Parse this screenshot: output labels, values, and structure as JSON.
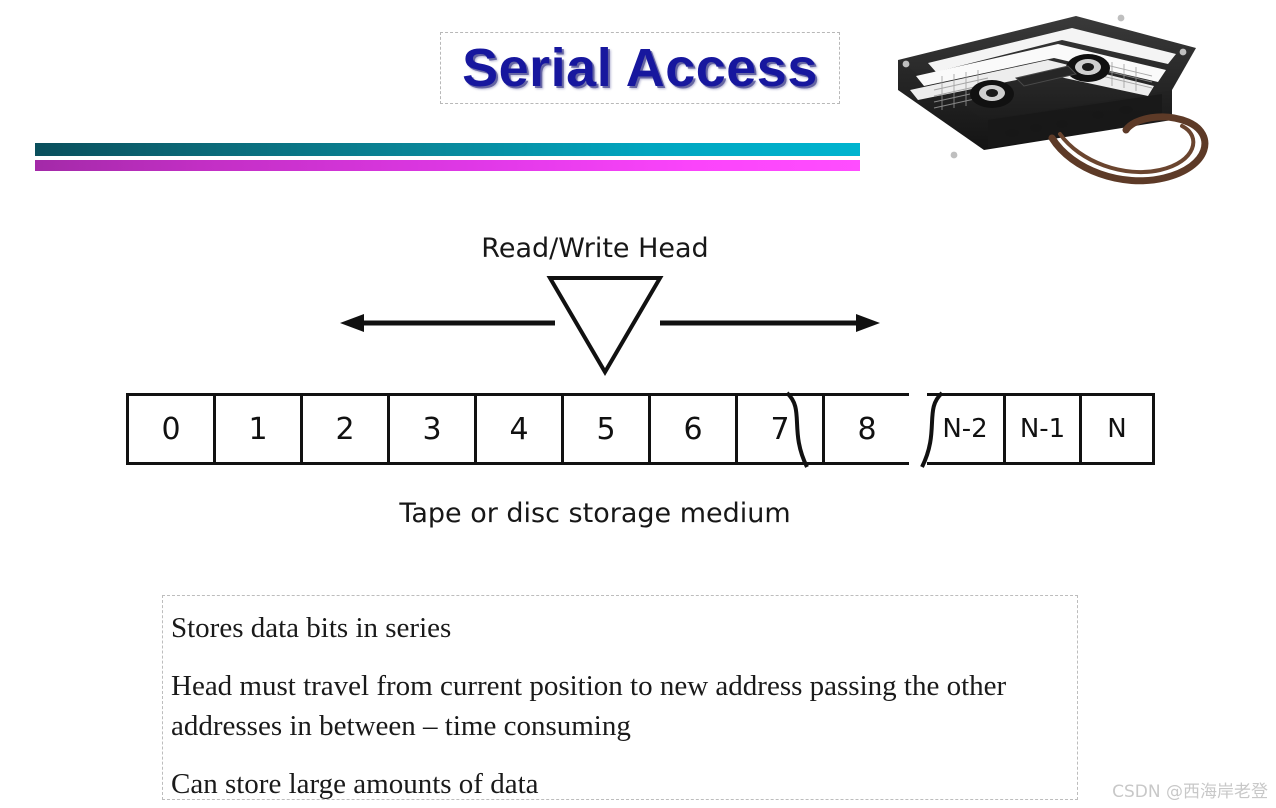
{
  "slide": {
    "title": "Serial Access",
    "title_color": "#17179e",
    "background": "#ffffff"
  },
  "divider_bars": [
    {
      "name": "teal-bar",
      "from": "#0a4f5c",
      "to": "#00b4cf"
    },
    {
      "name": "magenta-bar",
      "from": "#a32aa8",
      "to": "#ff4dff"
    }
  ],
  "image": {
    "alt": "cassette-tape-photo",
    "body_color": "#2b2b2b",
    "tape_color": "#5a3a2a",
    "label_color": "#f2f2f2"
  },
  "diagram": {
    "head_label": "Read/Write Head",
    "medium_caption": "Tape or disc storage medium",
    "cells_left": [
      "0",
      "1",
      "2",
      "3",
      "4",
      "5",
      "6",
      "7",
      "8"
    ],
    "cells_right": [
      "N-2",
      "N-1",
      "N"
    ],
    "arrow_left_direction": "left",
    "arrow_right_direction": "right"
  },
  "body_text": {
    "lines": [
      "Stores data bits in series",
      "Head must travel from current position to new address passing the other addresses in between – time consuming",
      "Can store large amounts of data"
    ]
  },
  "watermark": {
    "text": "CSDN @西海岸老登"
  }
}
